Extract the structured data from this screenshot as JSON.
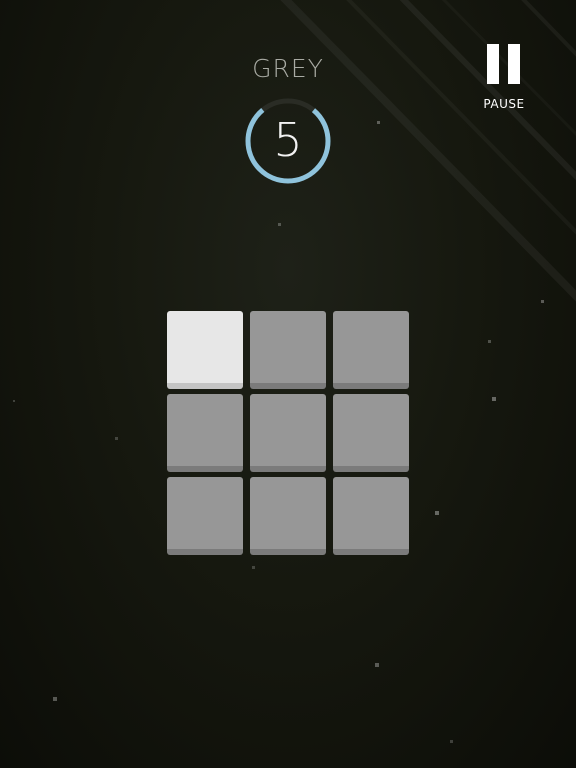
{
  "game": {
    "color_word": "GREY",
    "timer": {
      "value": "5",
      "remaining_fraction": 0.78,
      "ring_color": "#8fc3dc",
      "track_color": "#2a2c25"
    },
    "pause": {
      "icon": "pause-icon",
      "label": "PAUSE"
    },
    "grid": {
      "rows": 3,
      "cols": 3,
      "tiles": [
        {
          "face": "#e7e7e7",
          "edge": "#c4c4c4",
          "highlighted": true
        },
        {
          "face": "#979797",
          "edge": "#7b7b7b",
          "highlighted": false
        },
        {
          "face": "#979797",
          "edge": "#7b7b7b",
          "highlighted": false
        },
        {
          "face": "#979797",
          "edge": "#7b7b7b",
          "highlighted": false
        },
        {
          "face": "#979797",
          "edge": "#7b7b7b",
          "highlighted": false
        },
        {
          "face": "#979797",
          "edge": "#7b7b7b",
          "highlighted": false
        },
        {
          "face": "#979797",
          "edge": "#7b7b7b",
          "highlighted": false
        },
        {
          "face": "#979797",
          "edge": "#7b7b7b",
          "highlighted": false
        },
        {
          "face": "#979797",
          "edge": "#7b7b7b",
          "highlighted": false
        }
      ]
    }
  },
  "colors": {
    "background": "#16180f",
    "word": "#a9aba4",
    "pause": "#ffffff"
  }
}
